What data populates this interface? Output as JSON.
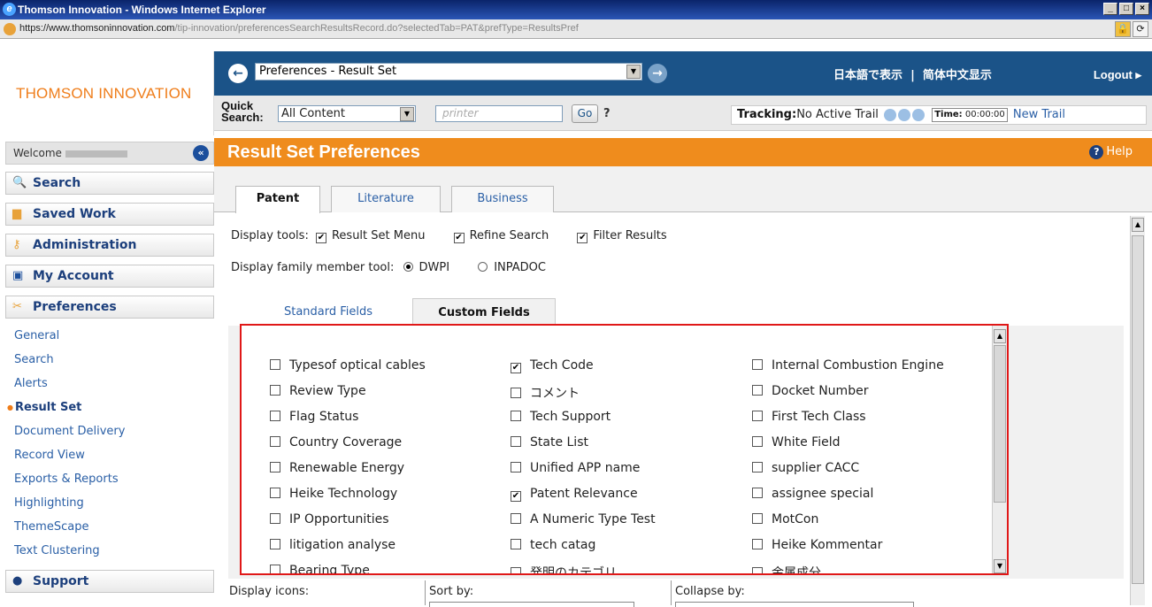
{
  "window": {
    "title": "Thomson Innovation - Windows Internet Explorer",
    "url_domain": "https://www.thomsoninnovation.com",
    "url_path": "/tip-innovation/preferencesSearchResultsRecord.do?selectedTab=PAT&prefType=ResultsPref"
  },
  "sidebar": {
    "logo": "THOMSON INNOVATION",
    "welcome": "Welcome",
    "sections": [
      {
        "label": "Search",
        "icon": "magnifier-icon"
      },
      {
        "label": "Saved Work",
        "icon": "folder-icon"
      },
      {
        "label": "Administration",
        "icon": "key-icon"
      },
      {
        "label": "My Account",
        "icon": "user-card-icon"
      },
      {
        "label": "Preferences",
        "icon": "tools-icon"
      }
    ],
    "preferences_items": [
      "General",
      "Search",
      "Alerts",
      "Result Set",
      "Document Delivery",
      "Record View",
      "Exports & Reports",
      "Highlighting",
      "ThemeScape",
      "Text Clustering"
    ],
    "active_item": "Result Set",
    "support": "Support"
  },
  "header": {
    "pref_select": "Preferences - Result Set",
    "lang_jp": "日本語で表示",
    "lang_sep": "|",
    "lang_cn": "简体中文显示",
    "logout": "Logout"
  },
  "quick_search": {
    "label": "Quick Search:",
    "scope": "All Content",
    "placeholder": "printer",
    "go": "Go",
    "help": "?",
    "tracking_label": "Tracking:",
    "tracking_value": "No Active Trail",
    "time_label": "Time:",
    "time_value": "00:00:00",
    "new_trail": "New Trail"
  },
  "page": {
    "title": "Result Set Preferences",
    "help": "Help",
    "tabs": [
      "Patent",
      "Literature",
      "Business"
    ],
    "active_tab": "Patent",
    "display_tools_label": "Display tools:",
    "display_tools": [
      {
        "label": "Result Set Menu",
        "checked": true
      },
      {
        "label": "Refine Search",
        "checked": true
      },
      {
        "label": "Filter Results",
        "checked": true
      }
    ],
    "family_label": "Display family member tool:",
    "family_options": [
      {
        "label": "DWPI",
        "selected": true
      },
      {
        "label": "INPADOC",
        "selected": false
      }
    ],
    "field_tabs": [
      "Standard Fields",
      "Custom Fields"
    ],
    "active_field_tab": "Custom Fields",
    "custom_fields": [
      [
        {
          "label": "Typesof optical cables",
          "checked": false
        },
        {
          "label": "Review Type",
          "checked": false
        },
        {
          "label": "Flag Status",
          "checked": false
        },
        {
          "label": "Country Coverage",
          "checked": false
        },
        {
          "label": "Renewable Energy",
          "checked": false
        },
        {
          "label": "Heike Technology",
          "checked": false
        },
        {
          "label": "IP Opportunities",
          "checked": false
        },
        {
          "label": "litigation analyse",
          "checked": false
        },
        {
          "label": "Bearing Type",
          "checked": false
        }
      ],
      [
        {
          "label": "Tech Code",
          "checked": true
        },
        {
          "label": "コメント",
          "checked": false
        },
        {
          "label": "Tech Support",
          "checked": false
        },
        {
          "label": "State List",
          "checked": false
        },
        {
          "label": "Unified APP name",
          "checked": false
        },
        {
          "label": "Patent Relevance",
          "checked": true
        },
        {
          "label": "A Numeric Type Test",
          "checked": false
        },
        {
          "label": "tech catag",
          "checked": false
        },
        {
          "label": "発明のカテゴリ",
          "checked": false
        }
      ],
      [
        {
          "label": "Internal Combustion Engine",
          "checked": false
        },
        {
          "label": "Docket Number",
          "checked": false
        },
        {
          "label": "First Tech Class",
          "checked": false
        },
        {
          "label": "White Field",
          "checked": false
        },
        {
          "label": "supplier CACC",
          "checked": false
        },
        {
          "label": "assignee special",
          "checked": false
        },
        {
          "label": "MotCon",
          "checked": false
        },
        {
          "label": "Heike Kommentar",
          "checked": false
        },
        {
          "label": "金属成分",
          "checked": false
        }
      ]
    ],
    "display_icons_label": "Display icons:",
    "sort_by_label": "Sort by:",
    "collapse_by_label": "Collapse by:"
  },
  "colors": {
    "orange": "#ef8c1d",
    "navy": "#1b5388",
    "link": "#2a5fa6",
    "highlight_border": "#e01818"
  }
}
